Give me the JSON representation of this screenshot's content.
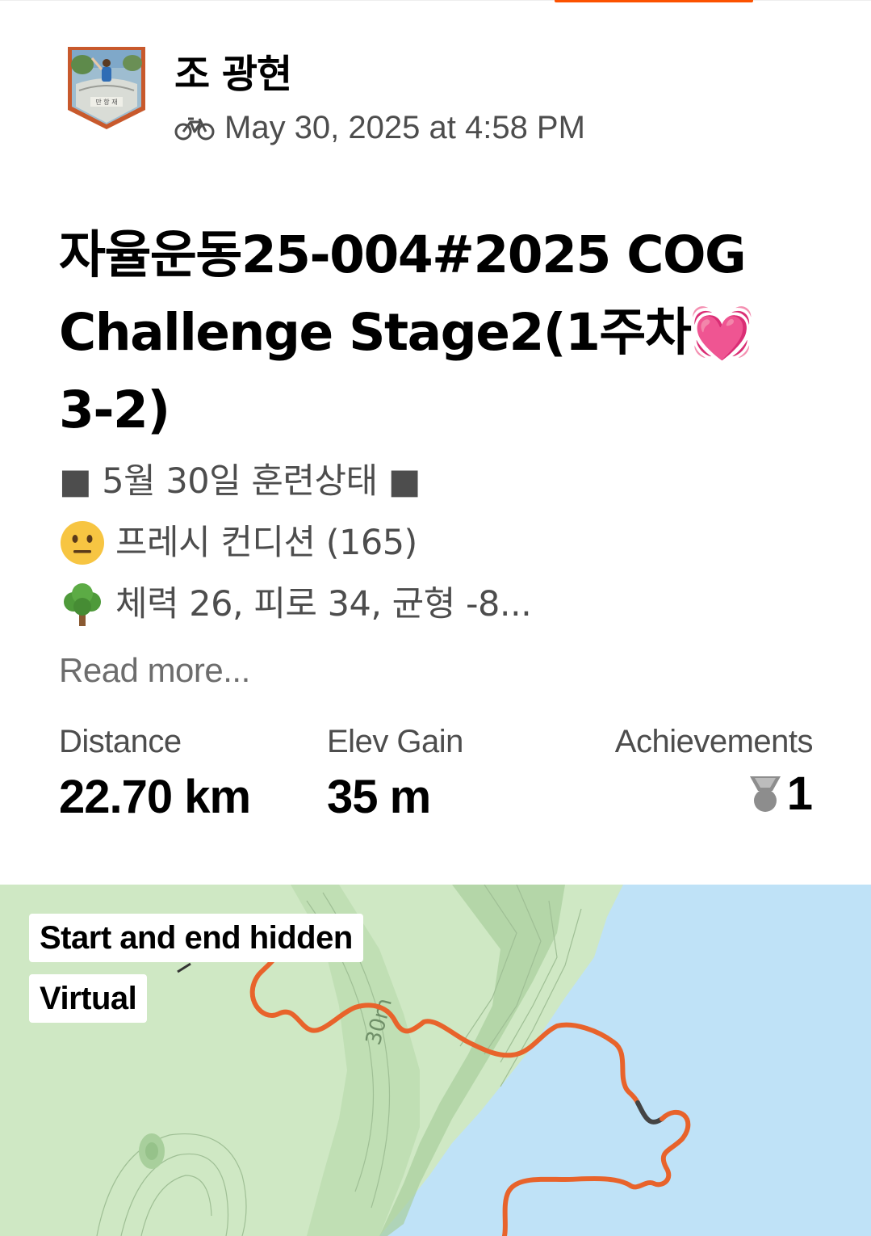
{
  "athlete": {
    "name": "조 광현",
    "avatar_icon": "avatar-photo-icon"
  },
  "activity": {
    "type_icon": "bike-icon",
    "datetime": "May 30, 2025 at 4:58 PM",
    "title": "자율운동25-004#2025 COG Challenge Stage2(1주차💓 3-2)",
    "description_lines": [
      "■ 5월 30일 훈련상태 ■",
      "프레시 컨디션 (165)",
      "체력 26, 피로 34, 균형 -8..."
    ],
    "description_emojis": [
      "neutral-face-icon",
      "tree-icon"
    ],
    "read_more": "Read more..."
  },
  "stats": {
    "distance_label": "Distance",
    "distance_value": "22.70 km",
    "elev_label": "Elev Gain",
    "elev_value": "35 m",
    "achievements_label": "Achievements",
    "achievements_value": "1",
    "achievements_icon": "medal-icon"
  },
  "map": {
    "tag_hidden": "Start and end hidden",
    "tag_virtual": "Virtual",
    "contour_label": "30m",
    "route_color": "#e8632b",
    "water_color": "#bfe2f7",
    "land_color": "#cfe8c4"
  },
  "colors": {
    "accent": "#fc5200",
    "text_secondary": "#4d4d4d"
  }
}
